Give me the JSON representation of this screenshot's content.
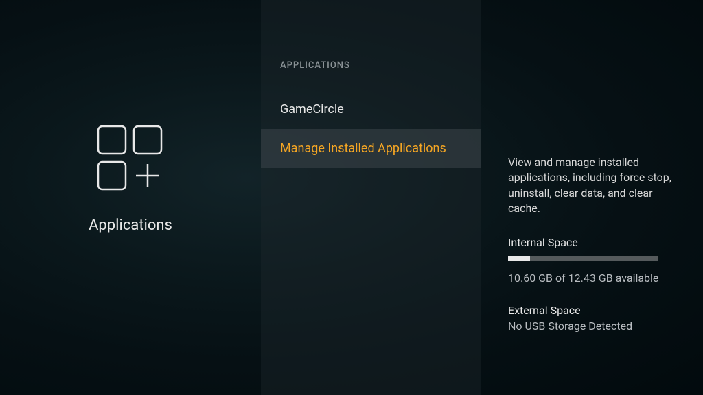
{
  "left": {
    "title": "Applications"
  },
  "middle": {
    "header": "APPLICATIONS",
    "items": [
      {
        "label": "GameCircle",
        "selected": false
      },
      {
        "label": "Manage Installed Applications",
        "selected": true
      }
    ]
  },
  "right": {
    "description": "View and manage installed applications, including force stop, uninstall, clear data, and clear cache.",
    "internal": {
      "label": "Internal Space",
      "used_gb": 1.83,
      "total_gb": 12.43,
      "available_gb": 10.6,
      "text": "10.60 GB of 12.43 GB available",
      "fill_percent": 14.7
    },
    "external": {
      "label": "External Space",
      "text": "No USB Storage Detected"
    }
  }
}
